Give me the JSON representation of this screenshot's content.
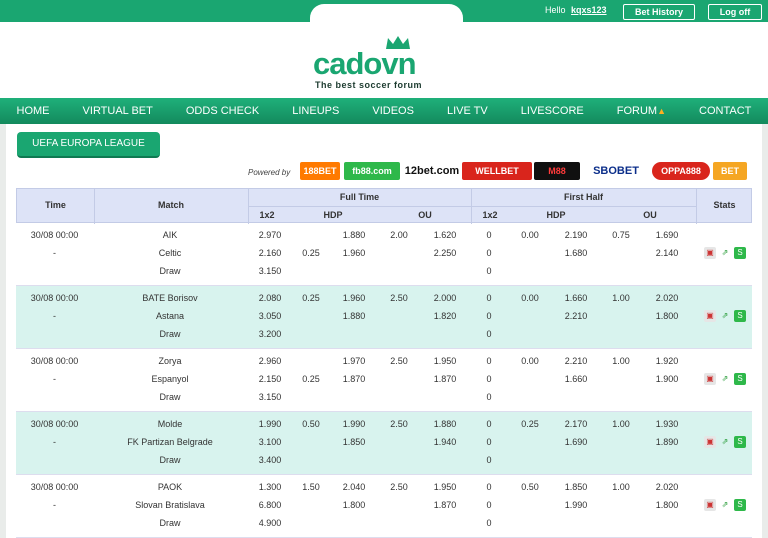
{
  "topbar": {
    "hello": "Hello",
    "username": "kqxs123",
    "bet_history": "Bet History",
    "logoff": "Log off"
  },
  "logo": {
    "text": "cadovn",
    "tagline": "The best soccer forum"
  },
  "nav": [
    "HOME",
    "VIRTUAL BET",
    "ODDS CHECK",
    "LINEUPS",
    "VIDEOS",
    "LIVE TV",
    "LIVESCORE",
    "FORUM",
    "CONTACT"
  ],
  "league": "UEFA EUROPA LEAGUE",
  "powered_by": "Powered by",
  "sponsors": [
    "188BET",
    "fb88.com",
    "12bet.com",
    "WELLBET",
    "M88",
    "SBOBET",
    "OPPA888",
    "BET"
  ],
  "table_headers": {
    "time": "Time",
    "match": "Match",
    "full_time": "Full Time",
    "first_half": "First Half",
    "x12": "1x2",
    "hdp": "HDP",
    "ou": "OU",
    "stats": "Stats"
  },
  "matches": [
    {
      "time": "30/08 00:00",
      "dash": "-",
      "home": "AIK",
      "away": "Celtic",
      "draw": "Draw",
      "ft_1x2": [
        "2.970",
        "2.160",
        "3.150"
      ],
      "ft_hdp": [
        "",
        "0.25",
        ""
      ],
      "ft_hdp_odds": [
        "1.880",
        "1.960",
        ""
      ],
      "ft_ou": [
        "2.00",
        "",
        ""
      ],
      "ft_ou_odds": [
        "1.620",
        "2.250",
        ""
      ],
      "fh_1x2": [
        "0",
        "0",
        "0"
      ],
      "fh_hdp": [
        "0.00",
        "",
        ""
      ],
      "fh_hdp_odds": [
        "2.190",
        "1.680",
        ""
      ],
      "fh_ou": [
        "0.75",
        "",
        ""
      ],
      "fh_ou_odds": [
        "1.690",
        "2.140",
        ""
      ]
    },
    {
      "time": "30/08 00:00",
      "dash": "-",
      "home": "BATE Borisov",
      "away": "Astana",
      "draw": "Draw",
      "ft_1x2": [
        "2.080",
        "3.050",
        "3.200"
      ],
      "ft_hdp": [
        "0.25",
        "",
        ""
      ],
      "ft_hdp_odds": [
        "1.960",
        "1.880",
        ""
      ],
      "ft_ou": [
        "2.50",
        "",
        ""
      ],
      "ft_ou_odds": [
        "2.000",
        "1.820",
        ""
      ],
      "fh_1x2": [
        "0",
        "0",
        "0"
      ],
      "fh_hdp": [
        "0.00",
        "",
        ""
      ],
      "fh_hdp_odds": [
        "1.660",
        "2.210",
        ""
      ],
      "fh_ou": [
        "1.00",
        "",
        ""
      ],
      "fh_ou_odds": [
        "2.020",
        "1.800",
        ""
      ]
    },
    {
      "time": "30/08 00:00",
      "dash": "-",
      "home": "Zorya",
      "away": "Espanyol",
      "draw": "Draw",
      "ft_1x2": [
        "2.960",
        "2.150",
        "3.150"
      ],
      "ft_hdp": [
        "",
        "0.25",
        ""
      ],
      "ft_hdp_odds": [
        "1.970",
        "1.870",
        ""
      ],
      "ft_ou": [
        "2.50",
        "",
        ""
      ],
      "ft_ou_odds": [
        "1.950",
        "1.870",
        ""
      ],
      "fh_1x2": [
        "0",
        "0",
        "0"
      ],
      "fh_hdp": [
        "0.00",
        "",
        ""
      ],
      "fh_hdp_odds": [
        "2.210",
        "1.660",
        ""
      ],
      "fh_ou": [
        "1.00",
        "",
        ""
      ],
      "fh_ou_odds": [
        "1.920",
        "1.900",
        ""
      ]
    },
    {
      "time": "30/08 00:00",
      "dash": "-",
      "home": "Molde",
      "away": "FK Partizan Belgrade",
      "draw": "Draw",
      "ft_1x2": [
        "1.990",
        "3.100",
        "3.400"
      ],
      "ft_hdp": [
        "0.50",
        "",
        ""
      ],
      "ft_hdp_odds": [
        "1.990",
        "1.850",
        ""
      ],
      "ft_ou": [
        "2.50",
        "",
        ""
      ],
      "ft_ou_odds": [
        "1.880",
        "1.940",
        ""
      ],
      "fh_1x2": [
        "0",
        "0",
        "0"
      ],
      "fh_hdp": [
        "0.25",
        "",
        ""
      ],
      "fh_hdp_odds": [
        "2.170",
        "1.690",
        ""
      ],
      "fh_ou": [
        "1.00",
        "",
        ""
      ],
      "fh_ou_odds": [
        "1.930",
        "1.890",
        ""
      ]
    },
    {
      "time": "30/08 00:00",
      "dash": "-",
      "home": "PAOK",
      "away": "Slovan Bratislava",
      "draw": "Draw",
      "ft_1x2": [
        "1.300",
        "6.800",
        "4.900"
      ],
      "ft_hdp": [
        "1.50",
        "",
        ""
      ],
      "ft_hdp_odds": [
        "2.040",
        "1.800",
        ""
      ],
      "ft_ou": [
        "2.50",
        "",
        ""
      ],
      "ft_ou_odds": [
        "1.950",
        "1.870",
        ""
      ],
      "fh_1x2": [
        "0",
        "0",
        "0"
      ],
      "fh_hdp": [
        "0.50",
        "",
        ""
      ],
      "fh_hdp_odds": [
        "1.850",
        "1.990",
        ""
      ],
      "fh_ou": [
        "1.00",
        "",
        ""
      ],
      "fh_ou_odds": [
        "2.020",
        "1.800",
        ""
      ]
    }
  ],
  "colors": {
    "brand": "#1aa671",
    "alt_row": "#d8f3ee",
    "header_bg": "#dde3f7"
  }
}
